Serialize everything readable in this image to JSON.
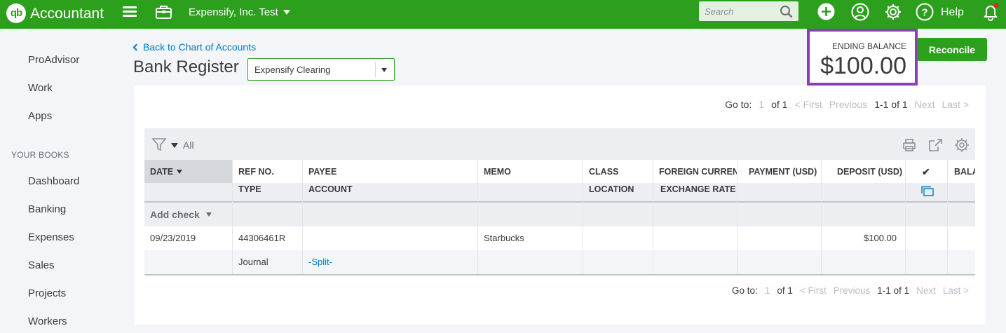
{
  "topbar": {
    "logo_text": "qb",
    "brand": "Accountant",
    "company": "Expensify, Inc. Test",
    "search_placeholder": "Search",
    "help_label": "Help",
    "bg_color": "#2ca01c"
  },
  "sidebar": {
    "items_top": [
      "ProAdvisor",
      "Work",
      "Apps"
    ],
    "section_label": "YOUR BOOKS",
    "items_books": [
      "Dashboard",
      "Banking",
      "Expenses",
      "Sales",
      "Projects",
      "Workers"
    ]
  },
  "header": {
    "back_link": "Back to Chart of Accounts",
    "title": "Bank Register",
    "account_select_value": "Expensify Clearing",
    "ending_balance_label": "ENDING BALANCE",
    "ending_balance": "$100.00",
    "reconcile_label": "Reconcile",
    "highlight_color": "#8a3fb3"
  },
  "pager": {
    "goto_label": "Go to:",
    "page_value": "1",
    "of_label": "of 1",
    "first": "< First",
    "previous": "Previous",
    "range": "1-1 of 1",
    "next": "Next",
    "last": "Last >"
  },
  "filter": {
    "value": "All",
    "icons": [
      "filter-icon",
      "print-icon",
      "export-icon",
      "settings-icon"
    ]
  },
  "table": {
    "headers_row1": {
      "date": "DATE",
      "ref_no": "REF NO.",
      "payee": "PAYEE",
      "memo": "MEMO",
      "class": "CLASS",
      "foreign_currency": "FOREIGN CURRENCY",
      "payment": "PAYMENT (USD)",
      "deposit": "DEPOSIT (USD)",
      "reconciled": "✔",
      "balance": "BALANCE"
    },
    "headers_row2": {
      "type": "TYPE",
      "account": "ACCOUNT",
      "location": "LOCATION",
      "exchange_rate": "EXCHANGE RATE"
    },
    "add_check_label": "Add check",
    "rows": [
      {
        "date": "09/23/2019",
        "ref_no": "44306461R",
        "payee": "",
        "memo": "Starbucks",
        "deposit": "$100.00",
        "type": "Journal",
        "account": "-Split-"
      }
    ]
  }
}
